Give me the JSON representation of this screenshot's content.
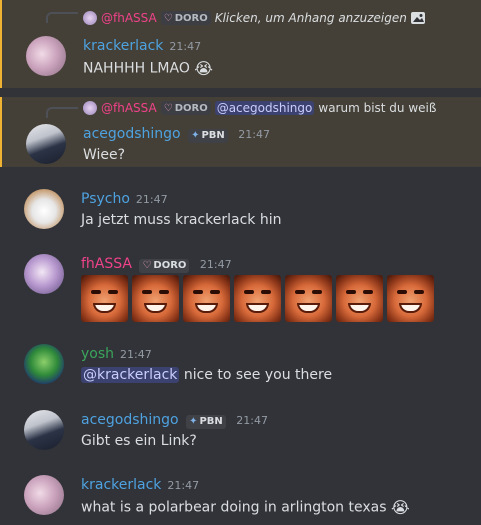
{
  "messages": [
    {
      "reply": {
        "author": "@fhASSA",
        "tag": "DORO",
        "text": "Klicken, um Anhang anzuzeigen"
      },
      "author": "krackerlack",
      "time": "21:47",
      "text": "NAHHHH LMAO",
      "emoji": "😭"
    },
    {
      "reply": {
        "author": "@fhASSA",
        "tag": "DORO",
        "mention": "@acegodshingo",
        "text": "warum bist du weiß"
      },
      "author": "acegodshingo",
      "tag": "PBN",
      "time": "21:47",
      "text": "Wiee?"
    },
    {
      "author": "Psycho",
      "time": "21:47",
      "text": "Ja jetzt muss krackerlack hin"
    },
    {
      "author": "fhASSA",
      "tag": "DORO",
      "time": "21:47",
      "image_count": 7
    },
    {
      "author": "yosh",
      "time": "21:47",
      "mention": "@krackerlack",
      "text": "nice to see you there"
    },
    {
      "author": "acegodshingo",
      "tag": "PBN",
      "time": "21:47",
      "text": "Gibt es ein Link?"
    },
    {
      "author": "krackerlack",
      "time": "21:47",
      "text": "what is a polarbear doing in arlington texas",
      "emoji": "😭"
    }
  ],
  "colors": {
    "background": "#313338",
    "highlight_bg": "#444037",
    "highlight_border": "#f0b232",
    "name_blue": "#4ea2e0",
    "name_pink": "#f0428a",
    "name_green": "#3ba55c"
  }
}
